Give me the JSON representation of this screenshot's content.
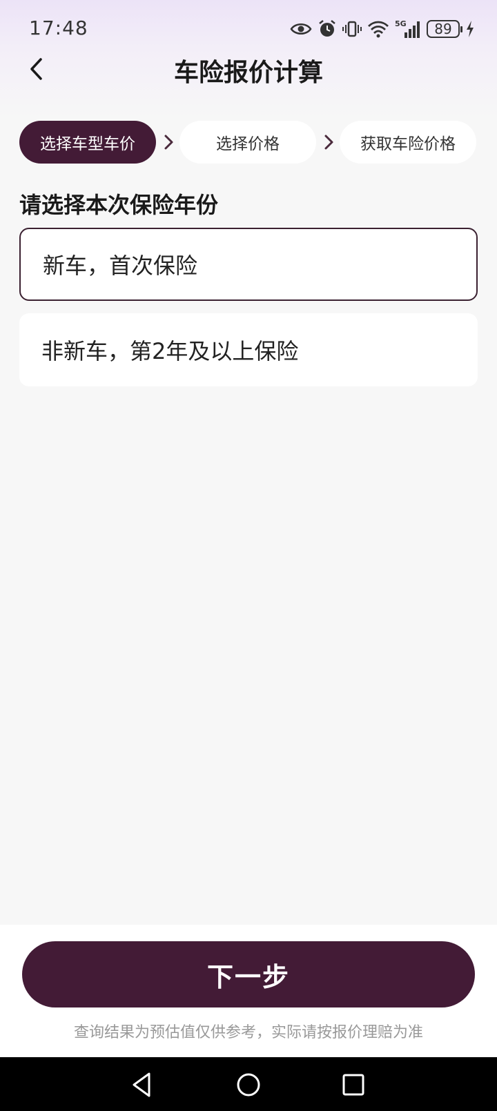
{
  "status_bar": {
    "time": "17:48",
    "battery": "89",
    "network": "5G"
  },
  "header": {
    "title": "车险报价计算"
  },
  "steps": [
    {
      "label": "选择车型车价",
      "active": true
    },
    {
      "label": "选择价格",
      "active": false
    },
    {
      "label": "获取车险价格",
      "active": false
    }
  ],
  "section": {
    "title": "请选择本次保险年份"
  },
  "options": [
    {
      "label": "新车，首次保险",
      "selected": true
    },
    {
      "label": "非新车，第2年及以上保险",
      "selected": false
    }
  ],
  "footer": {
    "next_label": "下一步",
    "disclaimer": "查询结果为预估值仅供参考，实际请按报价理赔为准"
  },
  "colors": {
    "accent": "#431b36",
    "background": "#f7f7f7",
    "card": "#ffffff",
    "muted_text": "#999999"
  },
  "icons": {
    "back": "back-arrow-icon",
    "step_separator": "chevron-right-icon",
    "status": [
      "eye-icon",
      "alarm-icon",
      "vibrate-icon",
      "wifi-icon",
      "signal-icon",
      "battery-icon",
      "charging-icon"
    ],
    "system_nav": [
      "nav-back-icon",
      "nav-home-icon",
      "nav-recents-icon"
    ]
  }
}
